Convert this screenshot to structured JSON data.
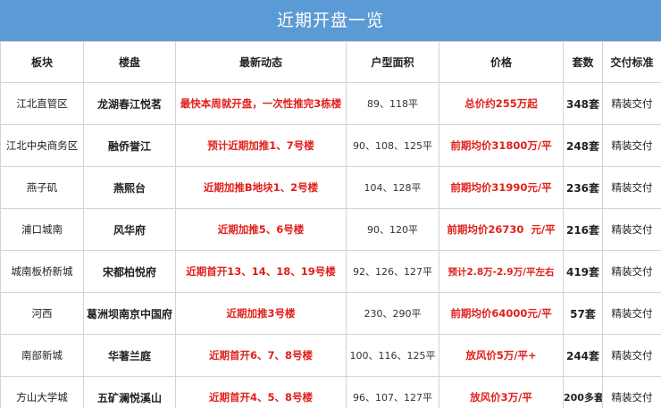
{
  "title": "近期开盘一览",
  "headers": {
    "region": "板块",
    "estate": "楼盘",
    "news": "最新动态",
    "area": "户型面积",
    "price": "价格",
    "units": "套数",
    "delivery": "交付标准"
  },
  "rows": [
    {
      "region": "江北直管区",
      "estate": "龙湖春江悦茗",
      "news": "最快本周就开盘，一次性推完3栋楼",
      "area": "89、118平",
      "price": "总价约255万起",
      "units": "348套",
      "delivery": "精装交付"
    },
    {
      "region": "江北中央商务区",
      "estate": "融侨誉江",
      "news": "预计近期加推1、7号楼",
      "area": "90、108、125平",
      "price": "前期均价31800万/平",
      "units": "248套",
      "delivery": "精装交付"
    },
    {
      "region": "燕子矶",
      "estate": "燕熙台",
      "news": "近期加推B地块1、2号楼",
      "area": "104、128平",
      "price": "前期均价31990元/平",
      "units": "236套",
      "delivery": "精装交付"
    },
    {
      "region": "浦口城南",
      "estate": "风华府",
      "news": "近期加推5、6号楼",
      "area": "90、120平",
      "price": "前期均价26730  元/平",
      "units": "216套",
      "delivery": "精装交付"
    },
    {
      "region": "城南板桥新城",
      "estate": "宋都柏悦府",
      "news": "近期首开13、14、18、19号楼",
      "area": "92、126、127平",
      "price": "预计2.8万-2.9万/平左右",
      "units": "419套",
      "delivery": "精装交付"
    },
    {
      "region": "河西",
      "estate": "葛洲坝南京中国府",
      "news": "近期加推3号楼",
      "area": "230、290平",
      "price": "前期均价64000元/平",
      "units": "57套",
      "delivery": "精装交付"
    },
    {
      "region": "南部新城",
      "estate": "华著兰庭",
      "news": "近期首开6、7、8号楼",
      "area": "100、116、125平",
      "price": "放风价5万/平+",
      "units": "244套",
      "delivery": "精装交付"
    },
    {
      "region": "方山大学城",
      "estate": "五矿澜悦溪山",
      "news": "近期首开4、5、8号楼",
      "area": "96、107、127平",
      "price": "放风价3万/平",
      "units": "200多套",
      "delivery": "精装交付"
    }
  ]
}
